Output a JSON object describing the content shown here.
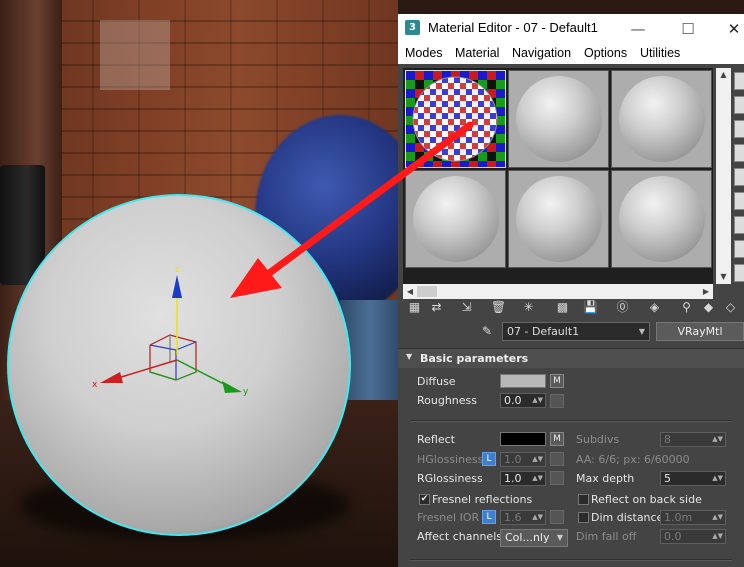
{
  "window": {
    "title": "Material Editor - 07 - Default1",
    "app_icon": "3",
    "minimize": "—",
    "maximize": "☐",
    "close": "✕"
  },
  "menu": [
    "Modes",
    "Material",
    "Navigation",
    "Options",
    "Utilities"
  ],
  "material": {
    "name": "07 - Default1",
    "type": "VRayMtl"
  },
  "rollout": {
    "title": "Basic parameters"
  },
  "params": {
    "diffuse_label": "Diffuse",
    "diffuse_color": "#b8b8b8",
    "m_label": "M",
    "l_label": "L",
    "roughness_label": "Roughness",
    "roughness_value": "0.0",
    "reflect_label": "Reflect",
    "reflect_color": "#000000",
    "subdivs_label": "Subdivs",
    "subdivs_value": "8",
    "hglossiness_label": "HGlossiness",
    "hglossiness_value": "1.0",
    "aa_text": "AA: 6/6; px: 6/60000",
    "rglossiness_label": "RGlossiness",
    "rglossiness_value": "1.0",
    "maxdepth_label": "Max depth",
    "maxdepth_value": "5",
    "fresnel_label": "Fresnel reflections",
    "fresnel_checked": true,
    "reflect_back_label": "Reflect on back side",
    "fresnel_ior_label": "Fresnel IOR",
    "fresnel_ior_value": "1.6",
    "dim_distance_label": "Dim distance",
    "dim_distance_value": "1.0m",
    "affect_label": "Affect channels",
    "affect_value": "Col...nly",
    "dim_falloff_label": "Dim fall off",
    "dim_falloff_value": "0.0"
  },
  "gizmo": {
    "x_label": "x",
    "y_label": "y",
    "z_label": "z"
  },
  "colors": {
    "selection_outline": "#41e8f0",
    "arrow": "#ff1a1a",
    "editor_bg": "#444444"
  }
}
